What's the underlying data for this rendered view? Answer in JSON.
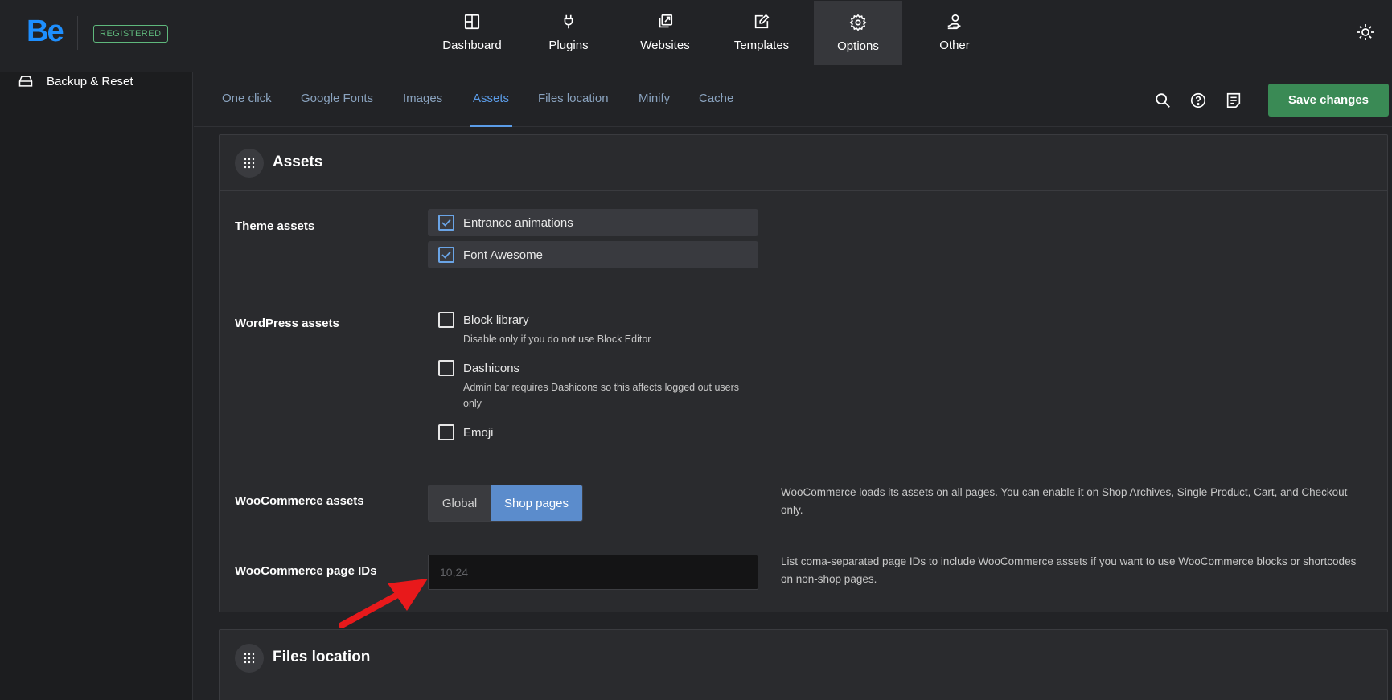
{
  "header": {
    "logo": "Be",
    "badge": "REGISTERED",
    "nav": [
      {
        "label": "Dashboard",
        "icon": "dashboard-icon"
      },
      {
        "label": "Plugins",
        "icon": "plug-icon"
      },
      {
        "label": "Websites",
        "icon": "websites-icon"
      },
      {
        "label": "Templates",
        "icon": "templates-icon"
      },
      {
        "label": "Options",
        "icon": "gear-icon",
        "active": true
      },
      {
        "label": "Other",
        "icon": "hand-user-icon"
      }
    ],
    "theme_toggle_icon": "sun-icon"
  },
  "sidebar": {
    "items": [
      {
        "label": "Backup & Reset",
        "icon": "drive-icon"
      }
    ]
  },
  "subtabs": [
    "One click",
    "Google Fonts",
    "Images",
    "Assets",
    "Files location",
    "Minify",
    "Cache"
  ],
  "active_subtab": "Assets",
  "toolbar": {
    "icons": [
      "search-icon",
      "help-icon",
      "notes-icon"
    ],
    "save_label": "Save changes"
  },
  "assets_panel": {
    "title": "Assets",
    "theme_assets": {
      "label": "Theme assets",
      "options": [
        {
          "label": "Entrance animations",
          "checked": true
        },
        {
          "label": "Font Awesome",
          "checked": true
        }
      ]
    },
    "wordpress_assets": {
      "label": "WordPress assets",
      "options": [
        {
          "label": "Block library",
          "checked": false,
          "desc": "Disable only if you do not use Block Editor"
        },
        {
          "label": "Dashicons",
          "checked": false,
          "desc": "Admin bar requires Dashicons so this affects logged out users only"
        },
        {
          "label": "Emoji",
          "checked": false
        }
      ]
    },
    "woo_assets": {
      "label": "WooCommerce assets",
      "options": [
        "Global",
        "Shop pages"
      ],
      "selected": "Shop pages",
      "help": "WooCommerce loads its assets on all pages. You can enable it on Shop Archives, Single Product, Cart, and Checkout only."
    },
    "woo_page_ids": {
      "label": "WooCommerce page IDs",
      "value": "",
      "placeholder": "10,24",
      "help": "List coma-separated page IDs to include WooCommerce assets if you want to use WooCommerce blocks or shortcodes on non-shop pages."
    }
  },
  "files_panel": {
    "title": "Files location"
  },
  "colors": {
    "accent": "#5b9ce8",
    "save": "#3a8a55",
    "logo": "#1e8fff",
    "badge": "#5fb87c",
    "arrow": "#e8191b"
  }
}
